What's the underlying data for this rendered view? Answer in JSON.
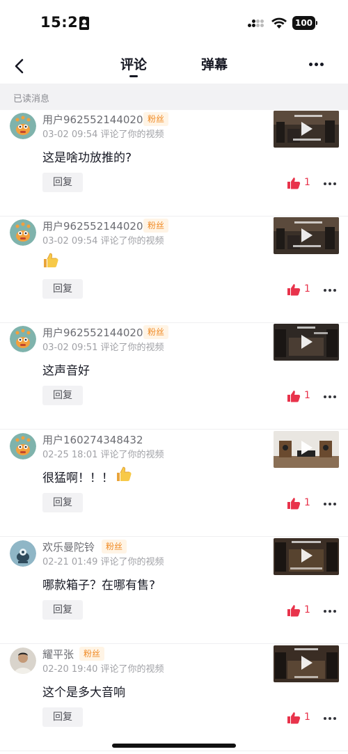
{
  "status_bar": {
    "time": "15:21",
    "battery": "100"
  },
  "nav": {
    "tab_comments": "评论",
    "tab_danmaku": "弹幕"
  },
  "section": {
    "read_label": "已读消息"
  },
  "colors": {
    "accent_like": "#e8334b",
    "fan_badge": "#f08a24",
    "avatar_teal": "#7fb3ac"
  },
  "items": [
    {
      "username": "用户962552144020",
      "badge": "粉丝",
      "meta": "03-02 09:54 评论了你的视频",
      "text": "这是啥功放推的?",
      "reply": "回复",
      "likes": "1"
    },
    {
      "username": "用户962552144020",
      "badge": "粉丝",
      "meta": "03-02 09:54 评论了你的视频",
      "text": "",
      "emoji": "thumbs-up-icon",
      "reply": "回复",
      "likes": "1"
    },
    {
      "username": "用户962552144020",
      "badge": "粉丝",
      "meta": "03-02 09:51 评论了你的视频",
      "text": "这声音好",
      "reply": "回复",
      "likes": "1"
    },
    {
      "username": "用户160274348432",
      "meta": "02-25 18:01 评论了你的视频",
      "text": "很猛啊！！！",
      "emoji": "thumbs-up-icon",
      "reply": "回复",
      "likes": "1"
    },
    {
      "username": "欢乐曼陀铃",
      "badge": "粉丝",
      "meta": "02-21 01:49 评论了你的视频",
      "text": "哪款箱子？在哪有售?",
      "reply": "回复",
      "likes": "1"
    },
    {
      "username": "耀平张",
      "badge": "粉丝",
      "meta": "02-20 19:40 评论了你的视频",
      "text": "这个是多大音响",
      "reply": "回复",
      "likes": "1"
    }
  ]
}
